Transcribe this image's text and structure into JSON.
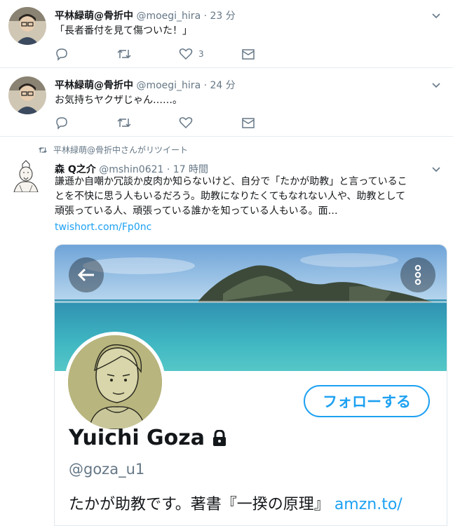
{
  "tweets": [
    {
      "name": "平林緑萌@骨折中",
      "handle": "@moegi_hira",
      "separator": "·",
      "time": "23 分",
      "text": "「長者番付を見て傷ついた！」",
      "like_count": "3"
    },
    {
      "name": "平林緑萌@骨折中",
      "handle": "@moegi_hira",
      "separator": "·",
      "time": "24 分",
      "text": "お気持ちヤクザじゃん……。",
      "like_count": ""
    }
  ],
  "retweet": {
    "context": "平林緑萌@骨折中さんがリツイート",
    "name": "森 Q之介",
    "handle": "@mshin0621",
    "separator": "·",
    "time": "17 時間",
    "text_lines": [
      "謙遜か自嘲か冗談か皮肉か知らないけど、自分で「たかが助教」と言っているこ",
      "とを不快に思う人もいるだろう。助教になりたくてもなれない人や、助教として",
      "頑張っている人、頑張っている誰かを知っている人もいる。面…"
    ],
    "link": "twishort.com/Fp0nc"
  },
  "card": {
    "follow_label": "フォローする",
    "name": "Yuichi Goza",
    "handle": "@goza_u1",
    "bio": "たかが助教です。著書『一揆の原理』",
    "bio_link": "amzn.to/"
  },
  "icons": {
    "reply": "reply-icon",
    "retweet": "retweet-icon",
    "like": "heart-icon",
    "dm": "envelope-icon",
    "caret": "chevron-down-icon",
    "lock": "lock-icon",
    "back": "arrow-left-icon",
    "more": "more-vertical-icon"
  },
  "colors": {
    "accent": "#1da1f2",
    "secondary_text": "#657786",
    "primary_text": "#14171a",
    "divider": "#e6ecf0"
  }
}
